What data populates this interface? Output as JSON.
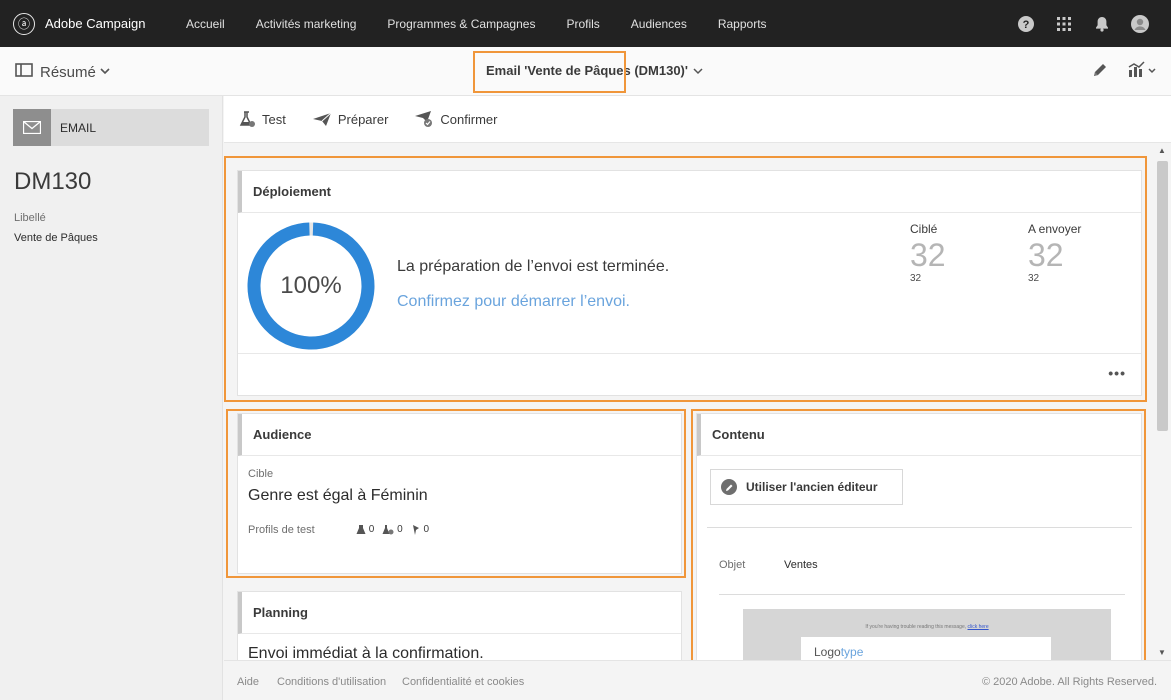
{
  "topbar": {
    "brand": "Adobe Campaign",
    "nav": [
      "Accueil",
      "Activités marketing",
      "Programmes & Campagnes",
      "Profils",
      "Audiences",
      "Rapports"
    ],
    "icons": [
      "help-icon",
      "apps-grid-icon",
      "notifications-bell-icon",
      "user-avatar-icon"
    ]
  },
  "subbar": {
    "view_label": "Résumé",
    "title": "Email 'Vente de Pâques (DM130)'"
  },
  "left": {
    "channel": "EMAIL",
    "code": "DM130",
    "libelle_label": "Libellé",
    "libelle_value": "Vente de Pâques"
  },
  "toolbar": {
    "test": "Test",
    "preparer": "Préparer",
    "confirmer": "Confirmer"
  },
  "deploiement": {
    "title": "Déploiement",
    "progress_percent": 100,
    "progress_text": "100%",
    "status": "La préparation de l’envoi est terminée.",
    "link": "Confirmez pour démarrer l’envoi.",
    "cible_label": "Ciblé",
    "cible_value": "32",
    "cible_sub": "32",
    "envoyer_label": "A envoyer",
    "envoyer_value": "32",
    "envoyer_sub": "32"
  },
  "audience": {
    "title": "Audience",
    "cible_label": "Cible",
    "cible_value": "Genre est égal à Féminin",
    "profils_label": "Profils de test",
    "count1": "0",
    "count2": "0",
    "count3": "0"
  },
  "contenu": {
    "title": "Contenu",
    "editor_button": "Utiliser l'ancien éditeur",
    "objet_label": "Objet",
    "objet_value": "Ventes",
    "preview_msg": "If you're having trouble reading this message, ",
    "preview_link": "click here",
    "logo_a": "Logo",
    "logo_b": "type"
  },
  "planning": {
    "title": "Planning",
    "value": "Envoi immédiat à la confirmation."
  },
  "footer": {
    "aide": "Aide",
    "conditions": "Conditions d'utilisation",
    "confidentialite": "Confidentialité et cookies",
    "copyright": "© 2020 Adobe. All Rights Reserved."
  },
  "colors": {
    "accent_blue": "#2d87d8",
    "link_blue": "#6aa4dd",
    "highlight_orange": "#f0963a",
    "topbar": "#222222"
  }
}
